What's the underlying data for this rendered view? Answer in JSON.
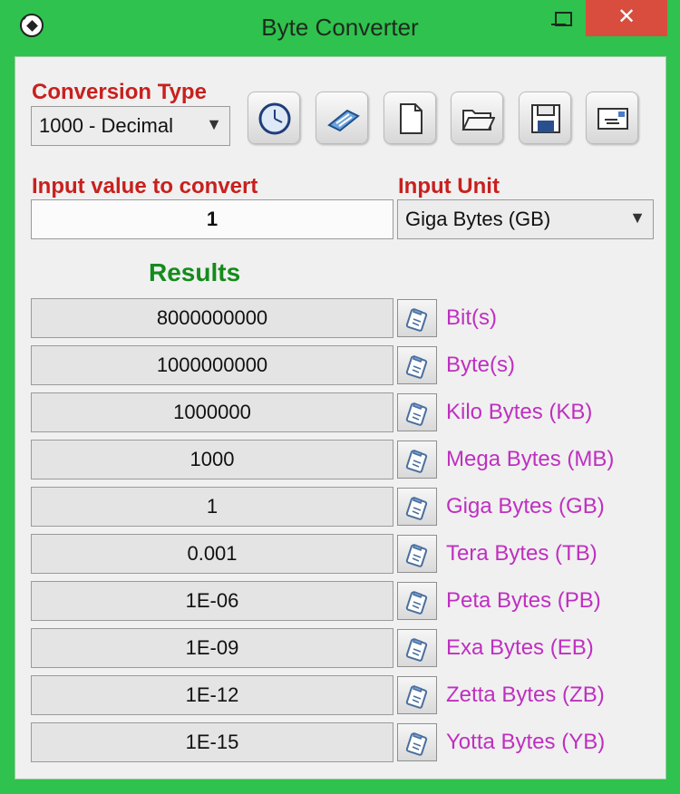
{
  "window": {
    "title": "Byte Converter",
    "close_glyph": "✕"
  },
  "conversion_type": {
    "label": "Conversion Type",
    "selected": "1000 - Decimal"
  },
  "toolbar": {
    "buttons": [
      {
        "name": "clock-icon"
      },
      {
        "name": "calculator-icon"
      },
      {
        "name": "new-document-icon"
      },
      {
        "name": "open-folder-icon"
      },
      {
        "name": "save-disk-icon"
      },
      {
        "name": "mail-icon"
      }
    ]
  },
  "input": {
    "label": "Input value to convert",
    "value": "1",
    "unit_label": "Input Unit",
    "unit_selected": "Giga Bytes (GB)"
  },
  "results": {
    "title": "Results",
    "rows": [
      {
        "value": "8000000000",
        "unit": "Bit(s)"
      },
      {
        "value": "1000000000",
        "unit": "Byte(s)"
      },
      {
        "value": "1000000",
        "unit": "Kilo Bytes (KB)"
      },
      {
        "value": "1000",
        "unit": "Mega Bytes (MB)"
      },
      {
        "value": "1",
        "unit": "Giga Bytes (GB)"
      },
      {
        "value": "0.001",
        "unit": "Tera Bytes (TB)"
      },
      {
        "value": "1E-06",
        "unit": "Peta Bytes (PB)"
      },
      {
        "value": "1E-09",
        "unit": "Exa Bytes (EB)"
      },
      {
        "value": "1E-12",
        "unit": "Zetta Bytes (ZB)"
      },
      {
        "value": "1E-15",
        "unit": "Yotta Bytes (YB)"
      }
    ]
  },
  "colors": {
    "frame": "#2fc24e",
    "label_red": "#c8201d",
    "results_green": "#138c1a",
    "unit_magenta": "#bf2fc0"
  }
}
